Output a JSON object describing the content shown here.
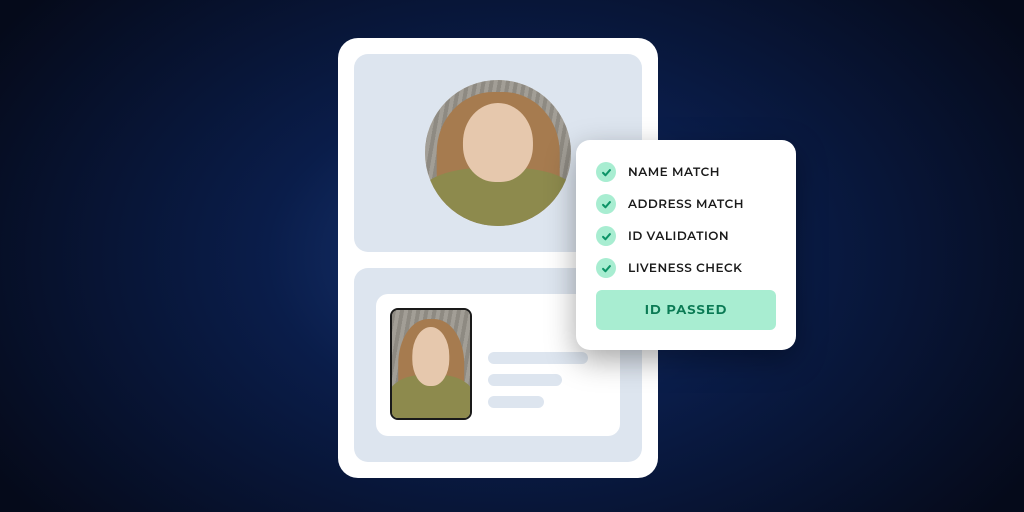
{
  "verification": {
    "checks": [
      {
        "label": "NAME MATCH"
      },
      {
        "label": "ADDRESS MATCH"
      },
      {
        "label": "ID VALIDATION"
      },
      {
        "label": "LIVENESS CHECK"
      }
    ],
    "result_label": "ID PASSED"
  },
  "colors": {
    "accent_bg": "#a8edd1",
    "accent_fg": "#0a7a54"
  }
}
